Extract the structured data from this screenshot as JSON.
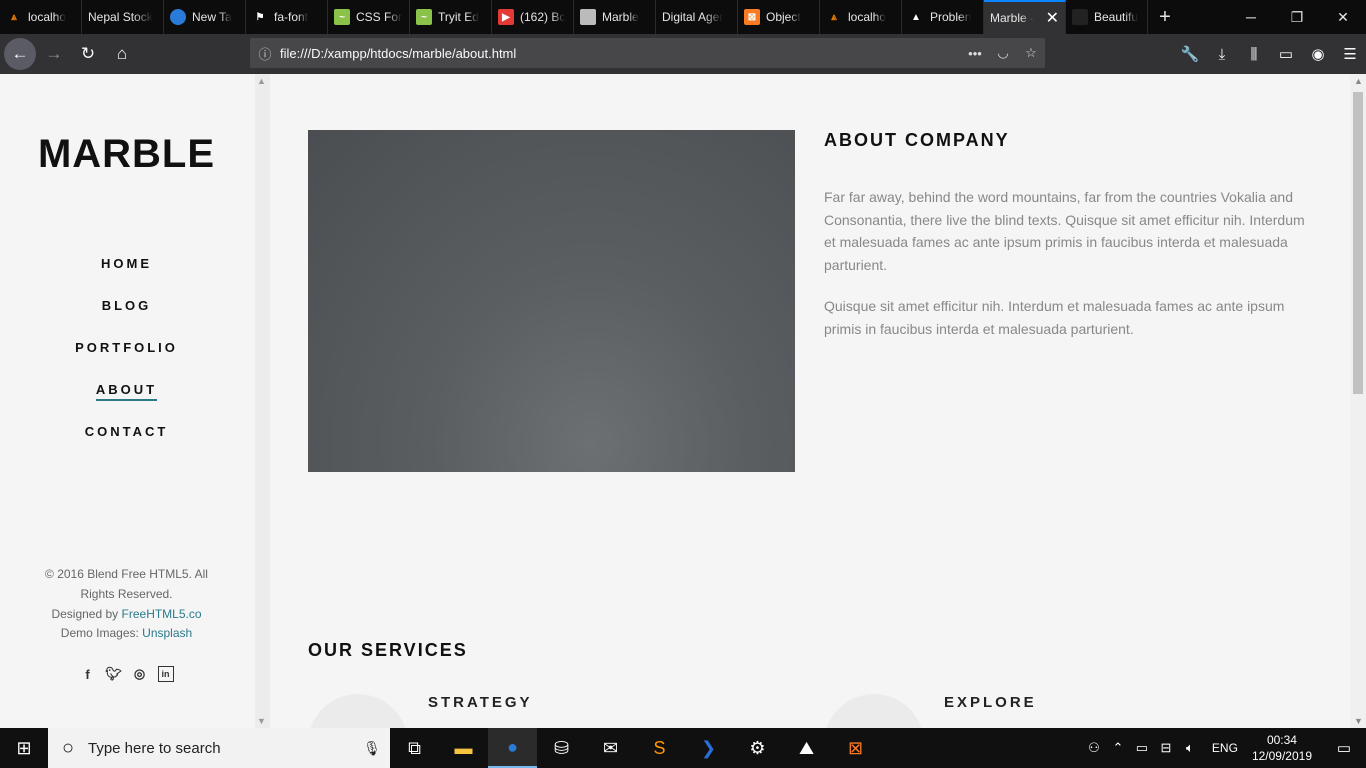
{
  "browser": {
    "tabs": [
      {
        "label": "localho",
        "icon": "xampp-icon",
        "color": "#f57c00"
      },
      {
        "label": "Nepal Stock",
        "icon": "",
        "color": ""
      },
      {
        "label": "New Ta",
        "icon": "firefox-icon",
        "color": "#2a7bd8"
      },
      {
        "label": "fa-font",
        "icon": "flag-icon",
        "color": ""
      },
      {
        "label": "CSS For",
        "icon": "chart-icon",
        "color": "#8bc34a"
      },
      {
        "label": "Tryit Ed",
        "icon": "chart-icon",
        "color": "#8bc34a"
      },
      {
        "label": "(162) Bc",
        "icon": "youtube-icon",
        "color": "#e53935"
      },
      {
        "label": "Marble",
        "icon": "image-icon",
        "color": "#bbbbbb"
      },
      {
        "label": "Digital Ager",
        "icon": "",
        "color": ""
      },
      {
        "label": "Object",
        "icon": "xampp-icon",
        "color": "#fb7a24"
      },
      {
        "label": "localho",
        "icon": "xampp-icon",
        "color": "#f57c00"
      },
      {
        "label": "Problen",
        "icon": "warning-icon",
        "color": "#ffffff"
      },
      {
        "label": "Marble -",
        "icon": "",
        "color": "",
        "active": true
      },
      {
        "label": "Beautifu",
        "icon": "bear-icon",
        "color": "#222222"
      }
    ],
    "url": "file:///D:/xampp/htdocs/marble/about.html",
    "accent": "#0a84ff"
  },
  "sidebar": {
    "logo": "MARBLE",
    "menu": [
      {
        "label": "HOME"
      },
      {
        "label": "BLOG"
      },
      {
        "label": "PORTFOLIO"
      },
      {
        "label": "ABOUT",
        "active": true
      },
      {
        "label": "CONTACT"
      }
    ],
    "copyright": "© 2016 Blend Free HTML5. All Rights Reserved.",
    "designed_by_prefix": "Designed by",
    "designed_by_link": "FreeHTML5.co",
    "demo_images_prefix": "Demo Images:",
    "demo_images_link": "Unsplash",
    "social": [
      "facebook-icon",
      "twitter-icon",
      "instagram-icon",
      "linkedin-icon"
    ]
  },
  "main": {
    "about_title": "ABOUT COMPANY",
    "about_p1": "Far far away, behind the word mountains, far from the countries Vokalia and Consonantia, there live the blind texts. Quisque sit amet efficitur nih. Interdum et malesuada fames ac ante ipsum primis in faucibus interda et malesuada parturient.",
    "about_p2": "Quisque sit amet efficitur nih. Interdum et malesuada fames ac ante ipsum primis in faucibus interda et malesuada parturient.",
    "services_title": "OUR SERVICES",
    "services": [
      {
        "label": "STRATEGY"
      },
      {
        "label": "EXPLORE"
      }
    ],
    "accent": "#2a7a8c"
  },
  "taskbar": {
    "search_placeholder": "Type here to search",
    "apps": [
      "task-view-icon",
      "file-explorer-icon",
      "firefox-icon",
      "store-icon",
      "mail-icon",
      "sublime-icon",
      "powershell-icon",
      "settings-icon",
      "photos-icon",
      "xampp-icon"
    ],
    "language": "ENG",
    "time": "00:34",
    "date": "12/09/2019"
  }
}
